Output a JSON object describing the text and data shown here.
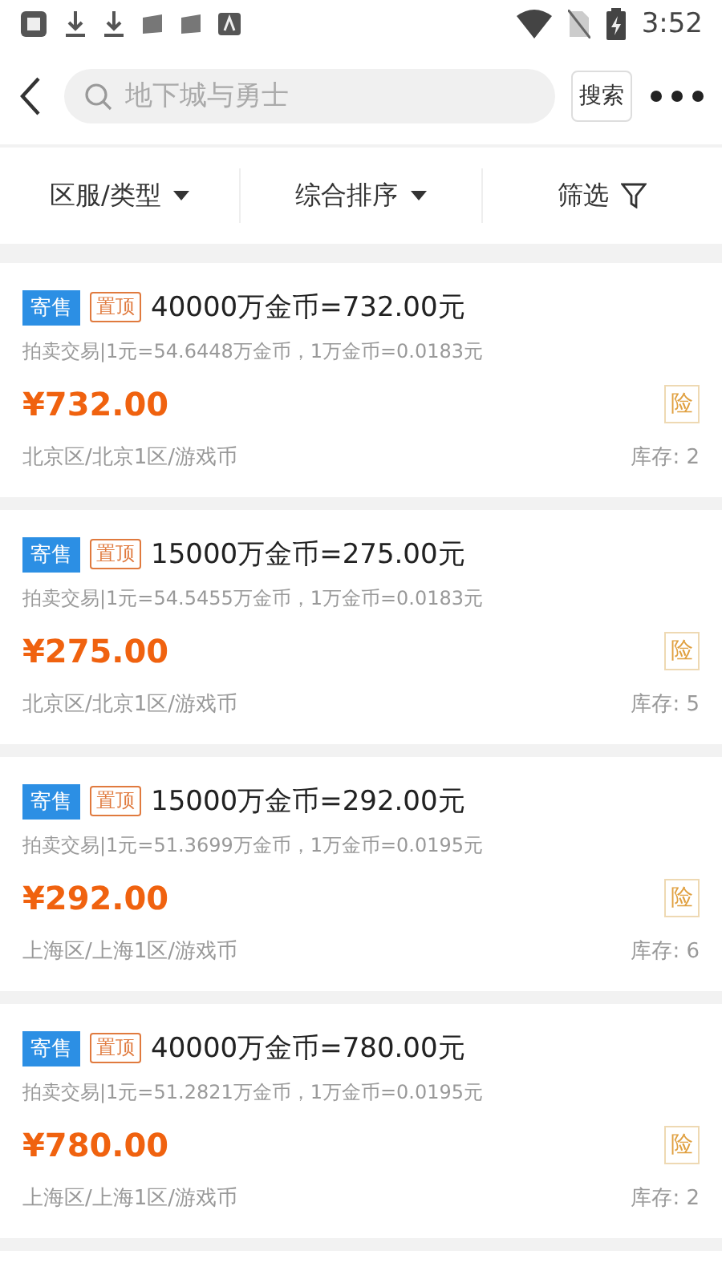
{
  "status_bar": {
    "time": "3:52"
  },
  "header": {
    "search": {
      "placeholder": "地下城与勇士"
    },
    "search_button": "搜索"
  },
  "filters": [
    {
      "label": "区服/类型",
      "kind": "dropdown"
    },
    {
      "label": "综合排序",
      "kind": "dropdown"
    },
    {
      "label": "筛选",
      "kind": "filter"
    }
  ],
  "listings": [
    {
      "sale_tag": "寄售",
      "top_tag": "置顶",
      "title": "40000万金币=732.00元",
      "rate": "拍卖交易|1元=54.6448万金币，1万金币=0.0183元",
      "price": "¥732.00",
      "insured": "险",
      "location": "北京区/北京1区/游戏币",
      "stock": "库存: 2"
    },
    {
      "sale_tag": "寄售",
      "top_tag": "置顶",
      "title": "15000万金币=275.00元",
      "rate": "拍卖交易|1元=54.5455万金币，1万金币=0.0183元",
      "price": "¥275.00",
      "insured": "险",
      "location": "北京区/北京1区/游戏币",
      "stock": "库存: 5"
    },
    {
      "sale_tag": "寄售",
      "top_tag": "置顶",
      "title": "15000万金币=292.00元",
      "rate": "拍卖交易|1元=51.3699万金币，1万金币=0.0195元",
      "price": "¥292.00",
      "insured": "险",
      "location": "上海区/上海1区/游戏币",
      "stock": "库存: 6"
    },
    {
      "sale_tag": "寄售",
      "top_tag": "置顶",
      "title": "40000万金币=780.00元",
      "rate": "拍卖交易|1元=51.2821万金币，1万金币=0.0195元",
      "price": "¥780.00",
      "insured": "险",
      "location": "上海区/上海1区/游戏币",
      "stock": "库存: 2"
    }
  ]
}
